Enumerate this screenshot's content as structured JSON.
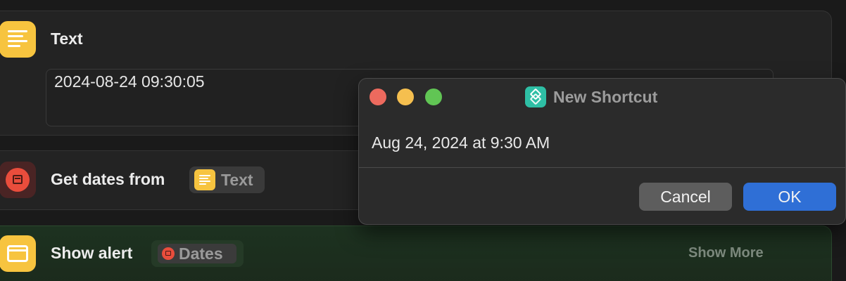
{
  "actions": {
    "text": {
      "title": "Text",
      "value": "2024-08-24 09:30:05"
    },
    "get_dates": {
      "title": "Get dates from",
      "token_label": "Text"
    },
    "show_alert": {
      "title": "Show alert",
      "token_label": "Dates",
      "show_more": "Show More"
    }
  },
  "dialog": {
    "title": "New Shortcut",
    "message": "Aug 24, 2024 at 9:30 AM",
    "cancel_label": "Cancel",
    "ok_label": "OK"
  },
  "icons": {
    "text_action": "text-lines-icon",
    "get_dates_action": "calendar-icon",
    "show_alert_action": "alert-window-icon",
    "shortcuts_app": "shortcuts-layers-icon"
  },
  "colors": {
    "text_icon": "#f7c43f",
    "dates_icon": "#e94d3c",
    "shortcuts_icon": "#2ebfa5",
    "ok_button": "#2f6fd6",
    "cancel_button": "#5d5d5d",
    "close_light": "#ed6a5e",
    "minimize_light": "#f5bf4f",
    "maximize_light": "#61c554"
  }
}
